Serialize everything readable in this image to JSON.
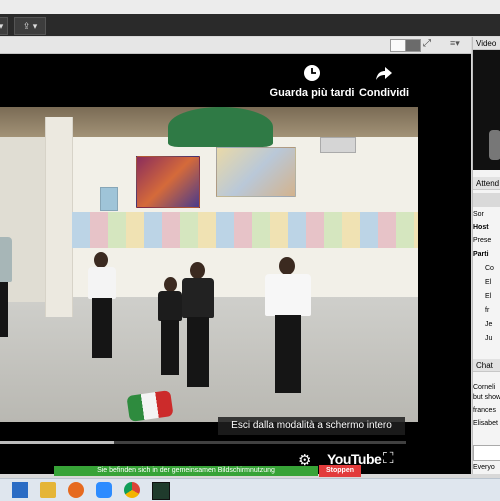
{
  "video": {
    "watch_later_label": "Guarda più tardi",
    "share_label": "Condividi",
    "exit_fullscreen_tip": "Esci dalla modalità a schermo intero",
    "progress_fraction": 0.28,
    "brand": "YouTube"
  },
  "right_panel": {
    "video_header": "Video",
    "attendees_header": "Attend",
    "rows": [
      "Sor",
      "Host",
      "Prese",
      "Parti"
    ],
    "participants": [
      "Co",
      "El",
      "El",
      "fr",
      "Je",
      "Ju"
    ],
    "chat_header": "Chat",
    "chat_lines": [
      "Corneli",
      "but show",
      "frances",
      "Elisabet"
    ],
    "chat_to": "Everyo"
  },
  "sharing_banner": {
    "message": "Sie befinden sich in der gemeinsamen Bildschirmnutzung",
    "stop_label": "Stoppen"
  },
  "colors": {
    "banner": "#37a337",
    "stop": "#e23b3b"
  }
}
